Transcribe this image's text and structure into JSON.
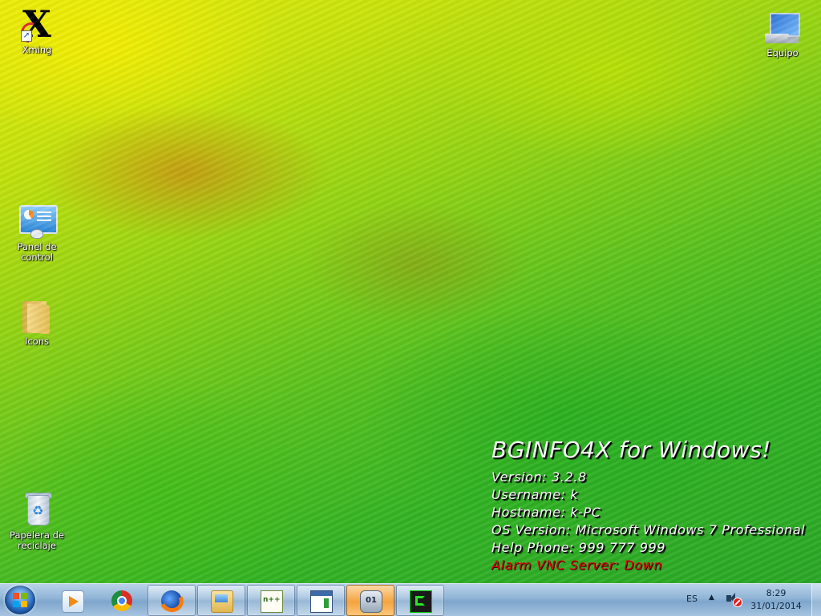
{
  "desktop": {
    "icons": [
      {
        "label": "Xming",
        "icon": "xming-x-icon"
      },
      {
        "label": "Equipo",
        "icon": "computer-monitor-icon"
      },
      {
        "label": "Panel de control",
        "icon": "control-panel-icon"
      },
      {
        "label": "Icons",
        "icon": "folder-icon"
      },
      {
        "label_line1": "Papelera de",
        "label_line2": "reciclaje",
        "icon": "recycle-bin-icon"
      }
    ]
  },
  "bginfo": {
    "title": "BGINFO4X for Windows!",
    "version": "Version: 3.2.8",
    "username": "Username: k",
    "hostname": "Hostname: k-PC",
    "os_version": "OS Version: Microsoft Windows 7 Professional",
    "help_phone": "Help Phone: 999 777 999",
    "alarm": "Alarm VNC Server: Down",
    "alarm_color": "#e00000"
  },
  "taskbar": {
    "pinned": [
      {
        "name": "windows-media-player",
        "icon": "media-player-icon",
        "state": "pinned"
      },
      {
        "name": "google-chrome",
        "icon": "chrome-icon",
        "state": "pinned"
      },
      {
        "name": "mozilla-firefox",
        "icon": "firefox-icon",
        "state": "running"
      },
      {
        "name": "windows-explorer",
        "icon": "explorer-folder-icon",
        "state": "running"
      },
      {
        "name": "notepad-plus-plus",
        "icon": "notepad-plus-plus-icon",
        "state": "running"
      },
      {
        "name": "application-window",
        "icon": "window-app-icon",
        "state": "running"
      },
      {
        "name": "system-tool",
        "icon": "system-tool-icon",
        "state": "active"
      },
      {
        "name": "green-app",
        "icon": "green-app-icon",
        "state": "running"
      }
    ],
    "tray": {
      "language": "ES",
      "time": "8:29",
      "date": "31/01/2014"
    }
  }
}
